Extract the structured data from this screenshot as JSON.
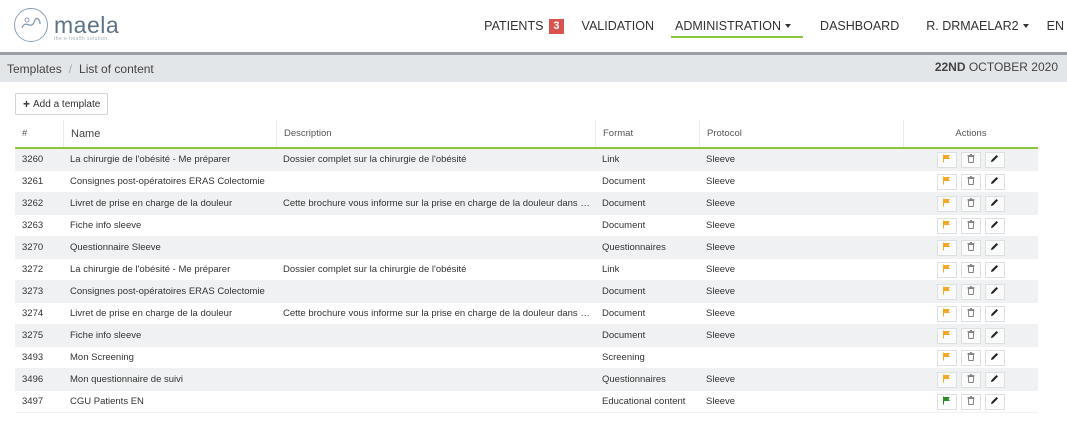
{
  "brand": {
    "name": "maela",
    "tagline": "the e-health solution"
  },
  "nav": {
    "patients": "PATIENTS",
    "patients_badge": "3",
    "validation": "VALIDATION",
    "administration": "ADMINISTRATION",
    "dashboard": "DASHBOARD",
    "user": "R. DRMAELAR2",
    "language": "EN"
  },
  "breadcrumb": {
    "root": "Templates",
    "separator": "/",
    "current": "List of content",
    "date_bold": "22ND",
    "date_rest": " OCTOBER 2020"
  },
  "toolbar": {
    "add_label": "Add a template"
  },
  "table": {
    "headers": {
      "id": "#",
      "name": "Name",
      "description": "Description",
      "format": "Format",
      "protocol": "Protocol",
      "actions": "Actions"
    },
    "rows": [
      {
        "id": "3260",
        "name": "La chirurgie de l'obésité - Me préparer",
        "description": "Dossier complet sur la chirurgie de l'obésité",
        "format": "Link",
        "protocol": "Sleeve",
        "flag_color": "#f5a623"
      },
      {
        "id": "3261",
        "name": "Consignes post-opératoires ERAS Colectomie",
        "description": "",
        "format": "Document",
        "protocol": "Sleeve",
        "flag_color": "#f5a623"
      },
      {
        "id": "3262",
        "name": "Livret de prise en charge de la douleur",
        "description": "Cette brochure vous informe sur la prise en charge de la douleur dans notr...",
        "format": "Document",
        "protocol": "Sleeve",
        "flag_color": "#f5a623"
      },
      {
        "id": "3263",
        "name": "Fiche info sleeve",
        "description": "",
        "format": "Document",
        "protocol": "Sleeve",
        "flag_color": "#f5a623"
      },
      {
        "id": "3270",
        "name": "Questionnaire Sleeve",
        "description": "",
        "format": "Questionnaires",
        "protocol": "Sleeve",
        "flag_color": "#f5a623"
      },
      {
        "id": "3272",
        "name": "La chirurgie de l'obésité - Me préparer",
        "description": "Dossier complet sur la chirurgie de l'obésité",
        "format": "Link",
        "protocol": "Sleeve",
        "flag_color": "#f5a623"
      },
      {
        "id": "3273",
        "name": "Consignes post-opératoires ERAS Colectomie",
        "description": "",
        "format": "Document",
        "protocol": "Sleeve",
        "flag_color": "#f5a623"
      },
      {
        "id": "3274",
        "name": "Livret de prise en charge de la douleur",
        "description": "Cette brochure vous informe sur la prise en charge de la douleur dans notr...",
        "format": "Document",
        "protocol": "Sleeve",
        "flag_color": "#f5a623"
      },
      {
        "id": "3275",
        "name": "Fiche info sleeve",
        "description": "",
        "format": "Document",
        "protocol": "Sleeve",
        "flag_color": "#f5a623"
      },
      {
        "id": "3493",
        "name": "Mon Screening",
        "description": "",
        "format": "Screening",
        "protocol": "",
        "flag_color": "#f5a623"
      },
      {
        "id": "3496",
        "name": "Mon questionnaire de suivi",
        "description": "",
        "format": "Questionnaires",
        "protocol": "Sleeve",
        "flag_color": "#f5a623"
      },
      {
        "id": "3497",
        "name": "CGU Patients EN",
        "description": "",
        "format": "Educational content",
        "protocol": "Sleeve",
        "flag_color": "#2e8b2e"
      }
    ]
  },
  "colors": {
    "accent": "#8cc63f",
    "badge": "#d9534f",
    "flag_default": "#f5a623",
    "flag_active": "#2e8b2e"
  }
}
